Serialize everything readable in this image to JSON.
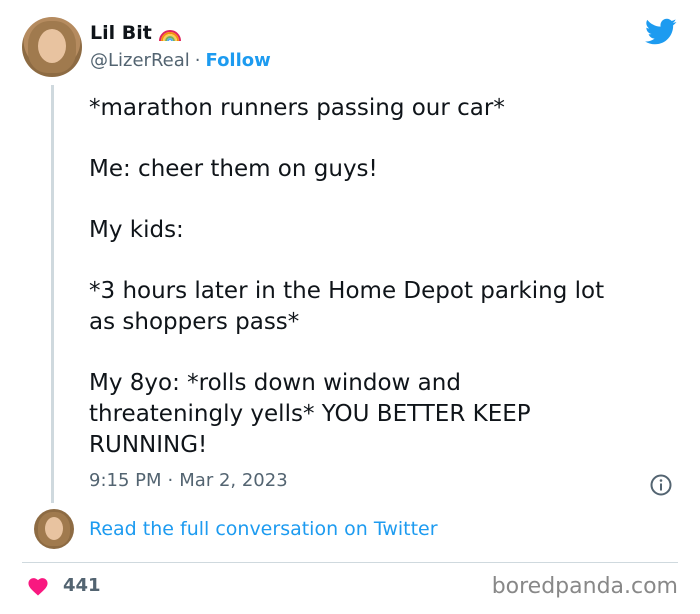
{
  "user": {
    "name": "Lil Bit",
    "handle": "@LizerReal",
    "separator": "·",
    "follow_label": "Follow"
  },
  "tweet": {
    "lines": [
      "*marathon runners passing our car*",
      "",
      "Me: cheer them on guys!",
      "",
      "My kids:",
      "",
      "*3 hours later in the Home Depot parking lot",
      "as shoppers pass*",
      "",
      "My 8yo: *rolls down window and",
      "threateningly yells* YOU BETTER KEEP",
      "RUNNING!"
    ],
    "time": "9:15 PM",
    "separator": "·",
    "date": "Mar 2, 2023"
  },
  "footer": {
    "read_more": "Read the full conversation on Twitter",
    "like_count": "441",
    "watermark": "boredpanda.com"
  },
  "colors": {
    "accent": "#1d9bf0",
    "text": "#0f1419",
    "muted": "#536471",
    "heart": "#f91880"
  },
  "icons": [
    "twitter-bird-icon",
    "rainbow-icon",
    "info-icon",
    "heart-icon"
  ]
}
